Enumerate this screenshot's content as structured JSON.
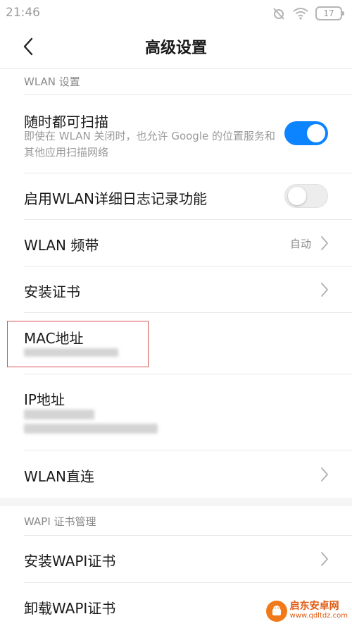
{
  "status_bar": {
    "time": "21:46",
    "battery": "17"
  },
  "nav": {
    "title": "高级设置"
  },
  "sections": {
    "wlan_header": "WLAN 设置",
    "wapi_header": "WAPI 证书管理"
  },
  "rows": {
    "scan_always": {
      "title": "随时都可扫描",
      "subtitle": "即使在 WLAN 关闭时，也允许 Google 的位置服务和其他应用扫描网络",
      "enabled": true
    },
    "verbose_logging": {
      "title": "启用WLAN详细日志记录功能",
      "enabled": false
    },
    "wlan_band": {
      "title": "WLAN 频带",
      "value": "自动"
    },
    "install_cert": {
      "title": "安装证书"
    },
    "mac_address": {
      "title": "MAC地址"
    },
    "ip_address": {
      "title": "IP地址"
    },
    "wlan_direct": {
      "title": "WLAN直连"
    },
    "install_wapi": {
      "title": "安装WAPI证书"
    },
    "uninstall_wapi": {
      "title": "卸载WAPI证书"
    }
  },
  "watermark": {
    "name": "启东安卓网",
    "url": "www.qdltdz.com"
  },
  "colors": {
    "accent": "#0d84ff",
    "highlight": "#d9534f",
    "watermark": "#f07a1a"
  }
}
